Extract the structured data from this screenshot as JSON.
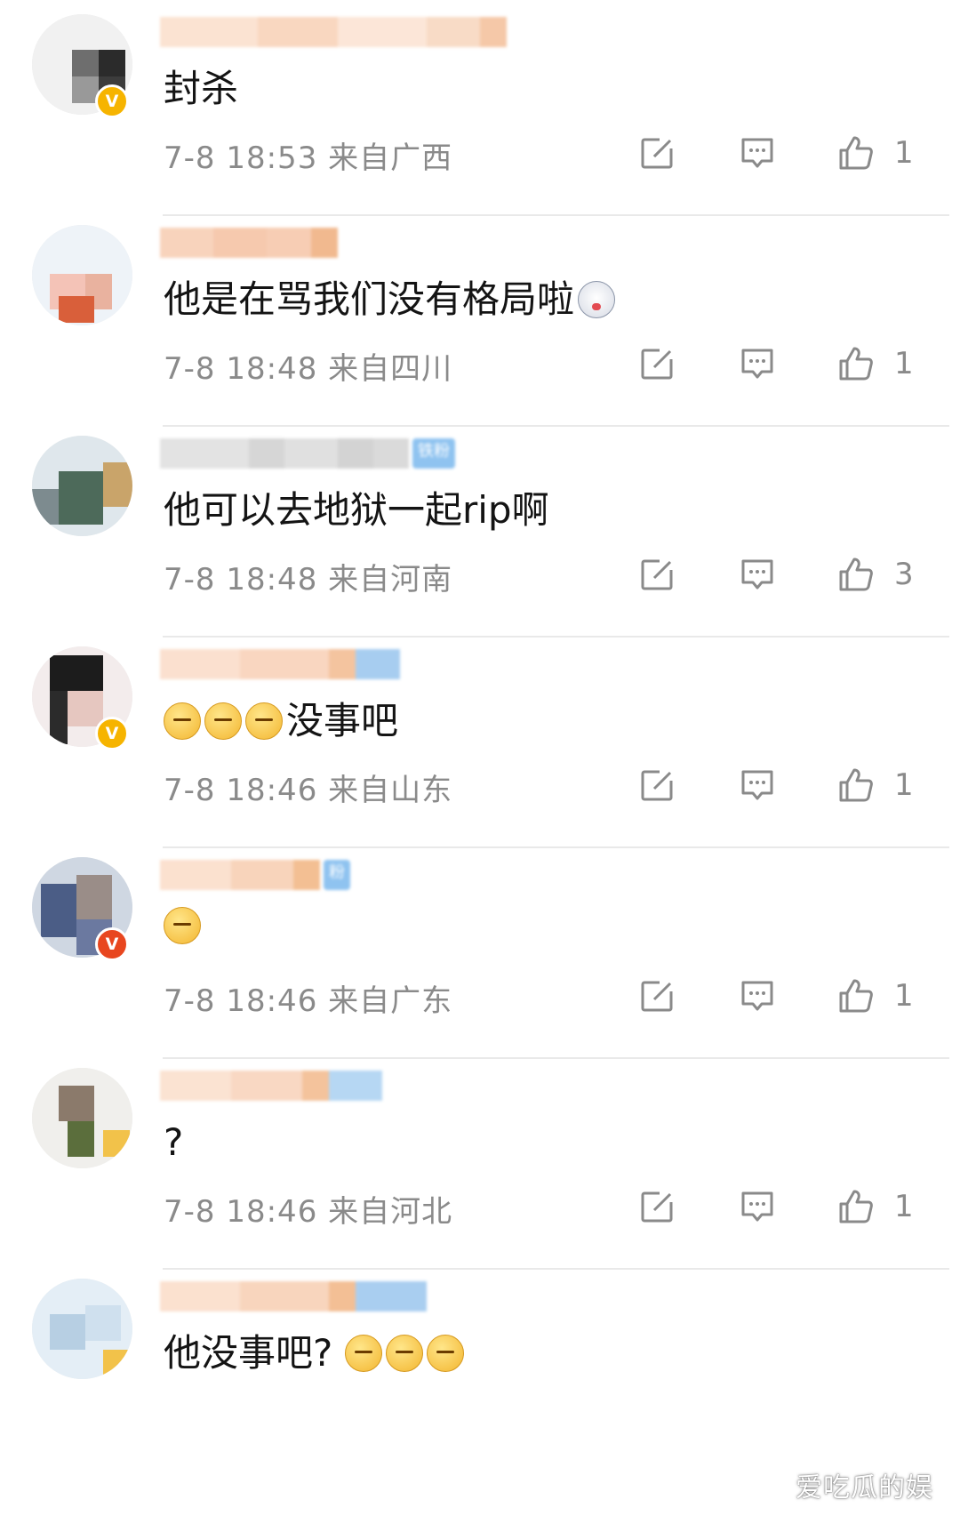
{
  "comments": [
    {
      "text": "封杀",
      "time": "7-8 18:53",
      "location": "来自广西",
      "likes": "1",
      "badge": "V",
      "emojis": []
    },
    {
      "text": "他是在骂我们没有格局啦",
      "time": "7-8 18:48",
      "location": "来自四川",
      "likes": "1",
      "badge": "",
      "emojis": [
        "doge-icon"
      ]
    },
    {
      "text": "他可以去地狱一起rip啊",
      "time": "7-8 18:48",
      "location": "来自河南",
      "likes": "3",
      "badge": "",
      "tag": "铁粉",
      "emojis": []
    },
    {
      "text": "没事吧",
      "time": "7-8 18:46",
      "location": "来自山东",
      "likes": "1",
      "badge": "V",
      "emojis_before": [
        "speechless-icon",
        "speechless-icon",
        "speechless-icon"
      ]
    },
    {
      "text": "",
      "time": "7-8 18:46",
      "location": "来自广东",
      "likes": "1",
      "badge": "V",
      "tag": "粉",
      "emojis": [
        "confused-icon"
      ]
    },
    {
      "text": "?",
      "time": "7-8 18:46",
      "location": "来自河北",
      "likes": "1",
      "badge": "",
      "emojis": []
    },
    {
      "text": "他没事吧?",
      "time": "",
      "location": "",
      "likes": "",
      "badge": "",
      "emojis": [
        "sweat-icon",
        "sweat-icon",
        "sweat-icon"
      ]
    }
  ],
  "icons": {
    "repost": "repost-icon",
    "reply": "comment-icon",
    "like": "thumbs-up-icon"
  },
  "watermark": "爱吃瓜的娱",
  "colors": {
    "meta": "#8a8a8a",
    "divider": "#e9e9e9",
    "badge_gold": "#f6b400",
    "tag_blue": "#8fc3f0"
  }
}
